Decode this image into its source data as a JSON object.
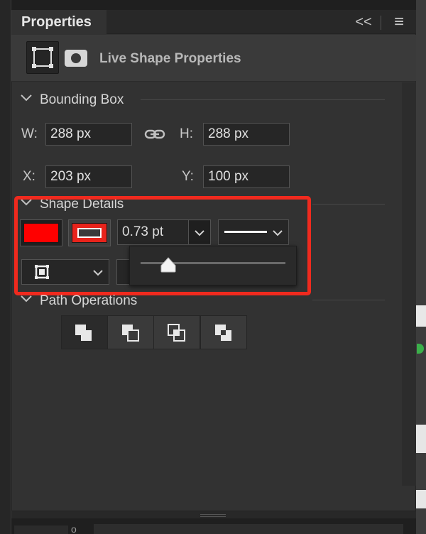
{
  "window": {
    "tab_title": "Properties",
    "collapse_glyph": "<<",
    "menu_glyph": "≡"
  },
  "header": {
    "title": "Live Shape Properties",
    "icons": [
      "bounding-box-shape-icon",
      "pixel-mask-icon"
    ]
  },
  "bounding_box": {
    "title": "Bounding Box",
    "w_label": "W:",
    "w_value": "288 px",
    "h_label": "H:",
    "h_value": "288 px",
    "x_label": "X:",
    "x_value": "203 px",
    "y_label": "Y:",
    "y_value": "100 px"
  },
  "shape_details": {
    "title": "Shape Details",
    "fill_color": "#ff0000",
    "stroke_color": "#e8231b",
    "stroke_width": "0.73 pt",
    "slider_fraction": 0.19
  },
  "path_operations": {
    "title": "Path Operations",
    "buttons": [
      "combine-shapes-icon",
      "subtract-front-shape-icon",
      "intersect-shape-areas-icon",
      "exclude-overlapping-shapes-icon"
    ]
  },
  "colors": {
    "panel": "#323232",
    "highlight": "#f02a1e"
  }
}
